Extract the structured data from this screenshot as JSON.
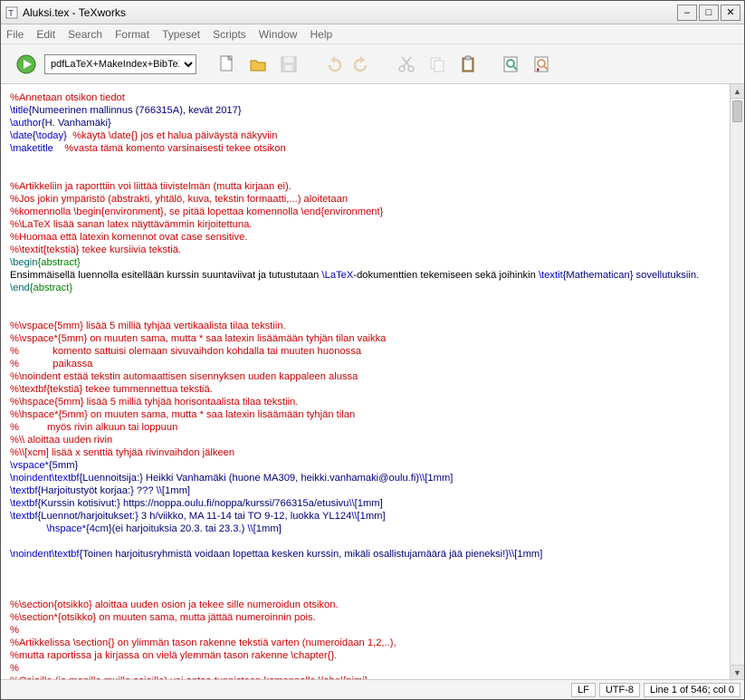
{
  "window": {
    "title": "Aluksi.tex - TeXworks"
  },
  "menu": {
    "file": "File",
    "edit": "Edit",
    "search": "Search",
    "format": "Format",
    "typeset": "Typeset",
    "scripts": "Scripts",
    "window": "Window",
    "help": "Help"
  },
  "toolbar": {
    "engine": "pdfLaTeX+MakeIndex+BibTeX"
  },
  "status": {
    "lf": "LF",
    "enc": "UTF-8",
    "pos": "Line 1 of 546; col 0"
  },
  "src": {
    "l1": "%Annetaan otsikon tiedot",
    "l2a": "\\title",
    "l2b": "{Numeerinen mallinnus (766315A), kevät 2017}",
    "l3a": "\\author",
    "l3b": "{H. Vanhamäki}",
    "l4a": "\\date",
    "l4b": "{",
    "l4c": "\\today",
    "l4d": "}  ",
    "l4e": "%käytä \\date{} jos et halua päiväystä näkyviin",
    "l5a": "\\maketitle",
    "l5b": "    %vasta tämä komento varsinaisesti tekee otsikon",
    "l6": "",
    "l7": "",
    "l8": "%Artikkeliin ja raporttiin voi liittää tiivistelmän (mutta kirjaan ei).",
    "l9": "%Jos jokin ympäristö (abstrakti, yhtälö, kuva, tekstin formaatti,...) aloitetaan",
    "l10": "%komennolla \\begin{environment}, se pitää lopettaa komennolla \\end{environment}",
    "l11": "%\\LaTeX lisää sanan latex näyttävämmin kirjoitettuna.",
    "l12": "%Huomaa että latexin komennot ovat case sensitive.",
    "l13": "%\\textit{tekstiä} tekee kursiivia tekstiä.",
    "l14a": "\\begin",
    "l14b": "{abstract}",
    "l15a": "Ensimmäisellä luennolla esitellään kurssin suuntaviivat ja tutustutaan ",
    "l15b": "\\LaTeX",
    "l15c": "-dokumenttien tekemiseen sekä joihinkin ",
    "l15d": "\\textit",
    "l15e": "{Mathematican} sovellutuksiin.",
    "l16a": "\\end",
    "l16b": "{abstract}",
    "l17": "",
    "l18": "",
    "l19": "%\\vspace{5mm} lisää 5 milliä tyhjää vertikaalista tilaa tekstiin.",
    "l20": "%\\vspace*{5mm} on muuten sama, mutta * saa latexin lisäämään tyhjän tilan vaikka",
    "l21": "%            komento sattuisi olemaan sivuvaihdon kohdalla tai muuten huonossa",
    "l22": "%            paikassa",
    "l23": "%\\noindent estää tekstin automaattisen sisennyksen uuden kappaleen alussa",
    "l24": "%\\textbf{tekstiä} tekee tummennettua tekstiä.",
    "l25": "%\\hspace{5mm} lisää 5 milliä tyhjää horisontaalista tilaa tekstiin.",
    "l26": "%\\hspace*{5mm} on muuten sama, mutta * saa latexin lisäämään tyhjän tilan",
    "l27": "%          myös rivin alkuun tai loppuun",
    "l28": "%\\\\ aloittaa uuden rivin",
    "l29": "%\\\\[xcm] lisää x senttiä tyhjää rivinvaihdon jälkeen",
    "l30a": "\\vspace*",
    "l30b": "{5mm}",
    "l31a": "\\noindent",
    "l31b": "\\textbf",
    "l31c": "{Luennoitsija:} Heikki Vanhamäki (huone MA309, heikki.vanhamaki@oulu.fi)",
    "l31d": "\\\\",
    "l31e": "[1mm]",
    "l32a": "\\textbf",
    "l32b": "{Harjoitustyöt korjaa:} ??? ",
    "l32c": "\\\\",
    "l32d": "[1mm]",
    "l33a": "\\textbf",
    "l33b": "{Kurssin kotisivut:} https://noppa.oulu.fi/noppa/kurssi/766315a/etusivu",
    "l33c": "\\\\",
    "l33d": "[1mm]",
    "l34a": "\\textbf",
    "l34b": "{Luennot/harjoitukset:} 3 h/viikko, MA 11-14 tai TO 9-12, luokka YL124",
    "l34c": "\\\\",
    "l34d": "[1mm]",
    "l35a": "             ",
    "l35b": "\\hspace*",
    "l35c": "{4cm}(ei harjoituksia 20.3. tai 23.3.) ",
    "l35d": "\\\\",
    "l35e": "[1mm]",
    "l36": "",
    "l37a": "\\noindent",
    "l37b": "\\textbf",
    "l37c": "{Toinen harjoitusryhmistä voidaan lopettaa kesken kurssin, mikäli osallistujamäärä jää pieneksi!}",
    "l37d": "\\\\",
    "l37e": "[1mm]",
    "l38": "",
    "l39": "",
    "l40": "",
    "l41": "%\\section{otsikko} aloittaa uuden osion ja tekee sille numeroidun otsikon.",
    "l42": "%\\section*{otsikko} on muuten sama, mutta jättää numeroinnin pois.",
    "l43": "%",
    "l44": "%Artikkelissa \\section{} on ylimmän tason rakenne tekstiä varten (numeroidaan 1,2,..),",
    "l45": "%mutta raportissa ja kirjassa on vielä ylemmän tason rakenne \\chapter{}.",
    "l46": "%",
    "l47": "%Osioille (ja monille muille asioille) voi antaa tunnisteen komennolla \\label{nimi},"
  }
}
